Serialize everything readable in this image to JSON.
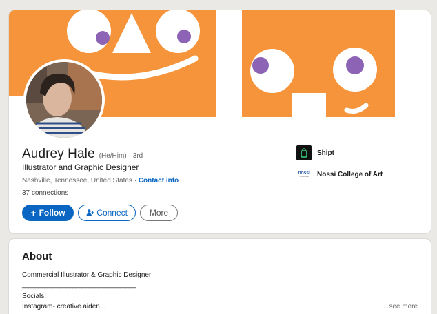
{
  "profile": {
    "name": "Audrey Hale",
    "pronouns": "(He/Him)",
    "degree": "· 3rd",
    "headline": "Illustrator and Graphic Designer",
    "location": "Nashville, Tennessee, United States",
    "location_separator": "·",
    "contact_link": "Contact info",
    "connections": "37 connections"
  },
  "actions": {
    "follow_icon": "+",
    "follow_label": "Follow",
    "connect_label": "Connect",
    "more_label": "More"
  },
  "affiliations": [
    {
      "name": "Shipt",
      "icon": "shipt-logo-icon"
    },
    {
      "name": "Nossi College of Art",
      "icon": "nossi-logo-icon",
      "logo_text": "nossi",
      "logo_subtext": "COLLEGE"
    }
  ],
  "about": {
    "title": "About",
    "lines": [
      "Commercial Illustrator & Graphic Designer",
      "____________________________________",
      "Socials:",
      "Instagram- creative.aiden..."
    ],
    "see_more": "...see more"
  },
  "colors": {
    "banner_orange": "#f5943a",
    "banner_purple": "#8d63b5",
    "brand_blue": "#0a66c2",
    "page_background": "#ebe9e6"
  }
}
